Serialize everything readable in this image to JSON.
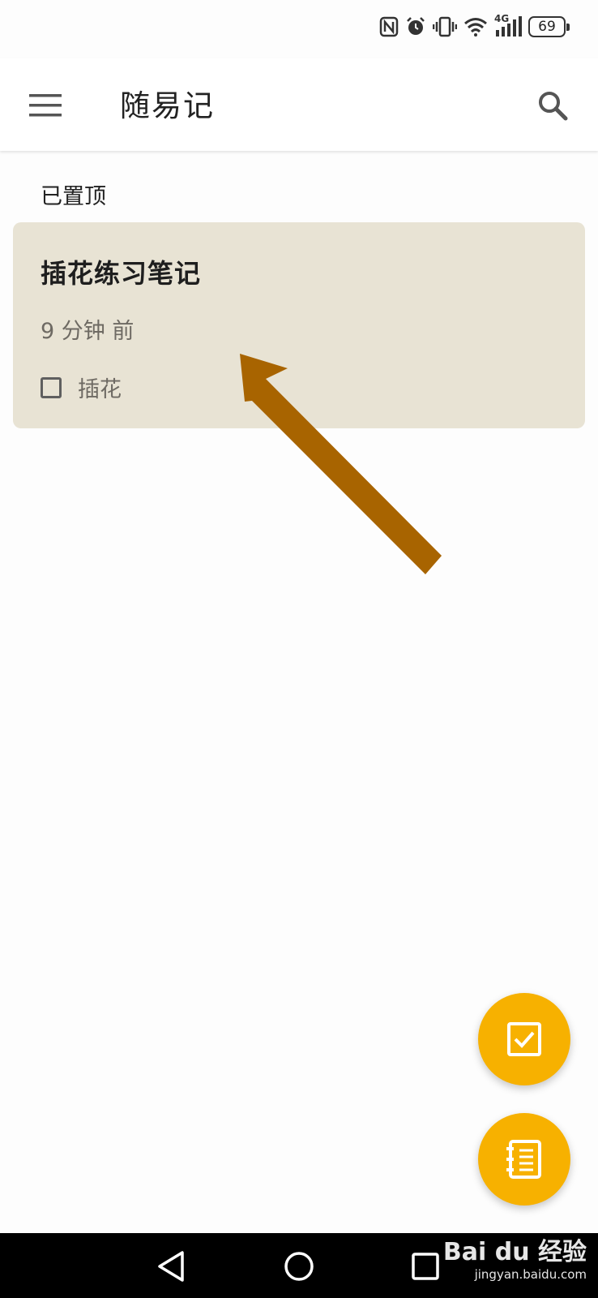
{
  "status_bar": {
    "network_label": "4G",
    "battery_level": "69",
    "icons": [
      "nfc-icon",
      "alarm-icon",
      "vibrate-icon",
      "wifi-icon",
      "signal-icon",
      "battery-icon"
    ]
  },
  "app_bar": {
    "title": "随易记",
    "menu_icon": "menu-icon",
    "search_icon": "search-icon"
  },
  "section": {
    "pinned_label": "已置顶"
  },
  "notes": [
    {
      "title": "插花练习笔记",
      "time": "9 分钟 前",
      "items": [
        {
          "text": "插花",
          "checked": false
        }
      ],
      "card_color": "#e8e3d4"
    }
  ],
  "fabs": {
    "checklist_icon": "checkbox-icon",
    "note_icon": "notebook-icon",
    "color": "#f7b100"
  },
  "annotation": {
    "arrow_color": "#a86400"
  },
  "nav_bar": {
    "back_icon": "back-triangle-icon",
    "home_icon": "home-circle-icon",
    "recents_icon": "recents-square-icon"
  },
  "watermark": {
    "main": "Bai du 经验",
    "sub": "jingyan.baidu.com"
  }
}
